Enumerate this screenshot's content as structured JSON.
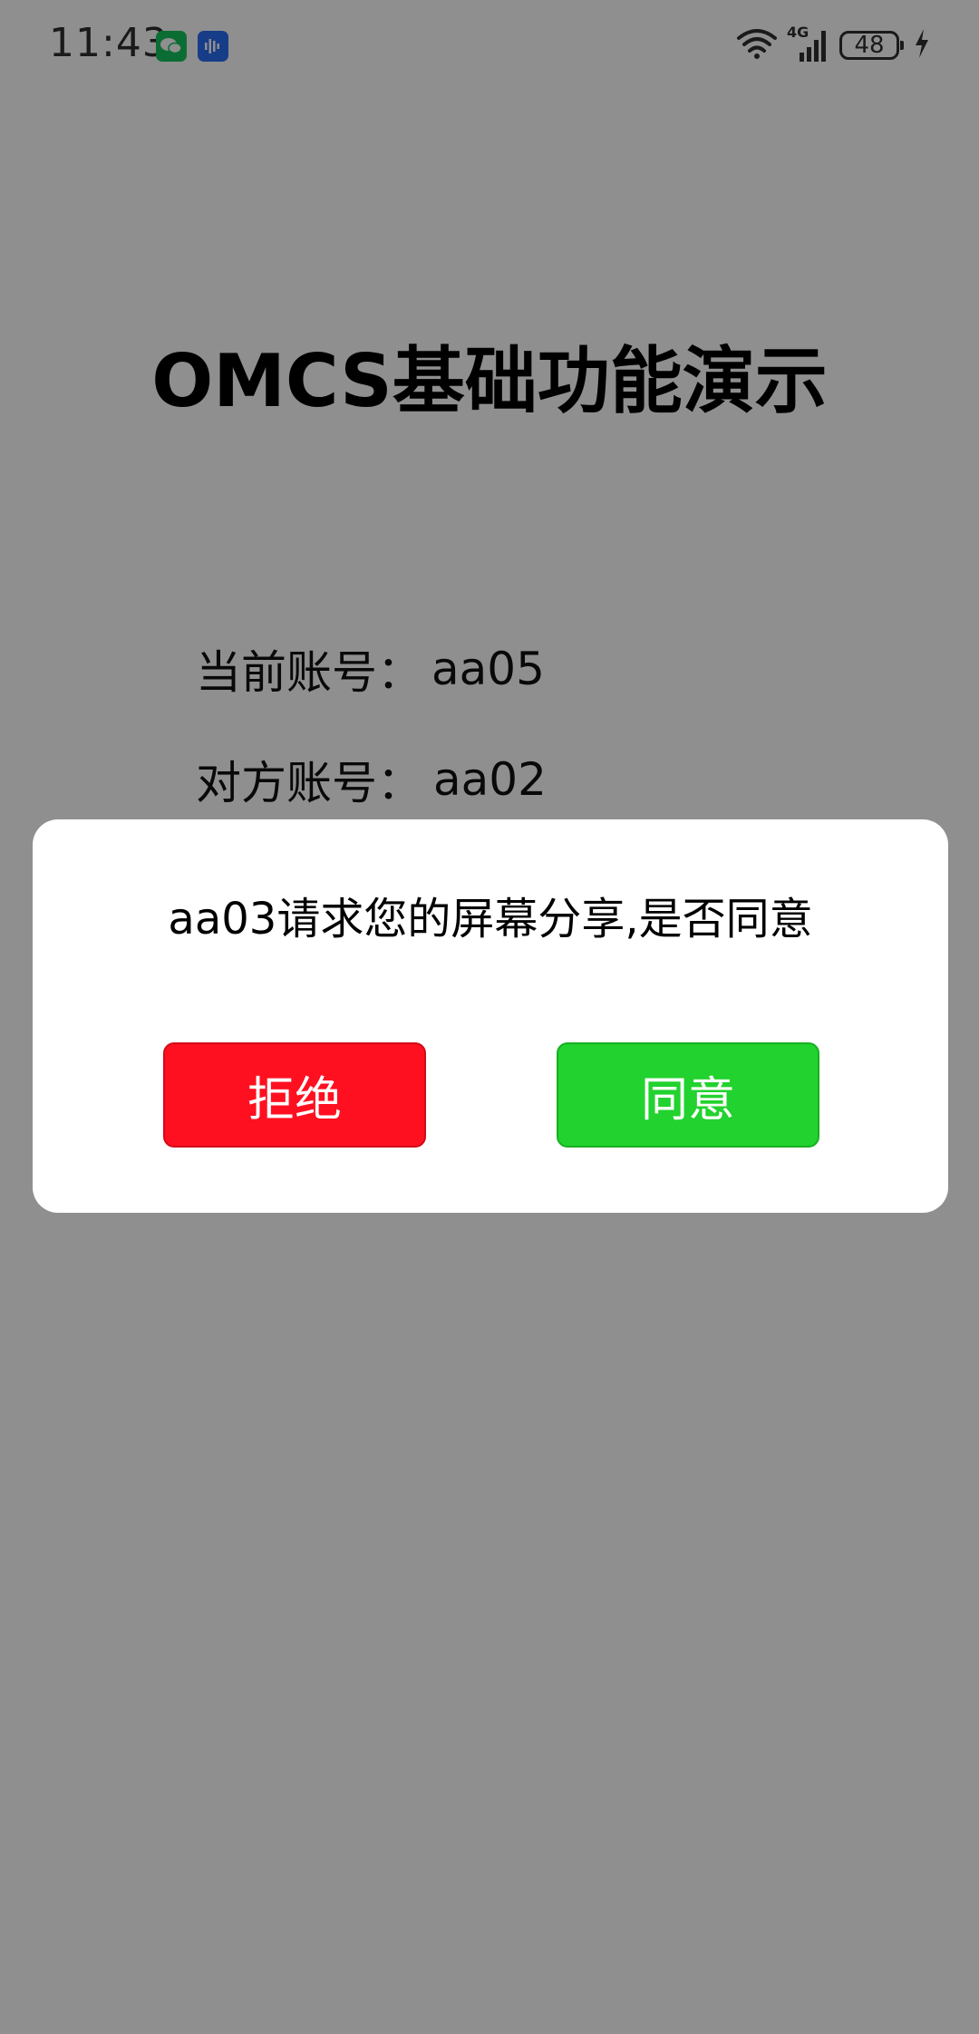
{
  "status_bar": {
    "time": "11:43",
    "battery_level": "48",
    "network_type": "4G",
    "notification_icons": [
      "wechat-icon",
      "voice-recorder-icon"
    ],
    "colors": {
      "wechat": "#15c35e",
      "voice": "#2a6df4"
    }
  },
  "app": {
    "title": "OMCS基础功能演示",
    "current_account": {
      "label": "当前账号：",
      "value": "aa05"
    },
    "peer_account": {
      "label": "对方账号：",
      "value": "aa02"
    }
  },
  "dialog": {
    "message": "aa03请求您的屏幕分享,是否同意",
    "reject_label": "拒绝",
    "accept_label": "同意",
    "colors": {
      "reject": "#ff1020",
      "accept": "#22d22e"
    }
  }
}
